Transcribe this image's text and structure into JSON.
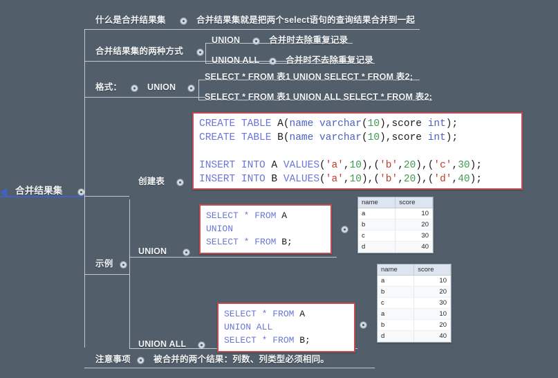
{
  "root": {
    "label": "合并结果集"
  },
  "branches": [
    {
      "key": "what",
      "label": "什么是合并结果集",
      "child": "合并结果集就是把两个select语句的查询结果合并到一起"
    },
    {
      "key": "ways",
      "label": "合并结果集的两种方式",
      "children": [
        {
          "label": "UNION",
          "desc": "合并时去除重复记录"
        },
        {
          "label": "UNION ALL",
          "desc": "合并时不去除重复记录"
        }
      ]
    },
    {
      "key": "format",
      "label": "格式：",
      "mid": "UNION",
      "children": [
        {
          "code": "SELECT * FROM 表1 UNION SELECT * FROM 表2;"
        },
        {
          "code": "SELECT * FROM 表1 UNION ALL SELECT * FROM 表2;"
        }
      ]
    },
    {
      "key": "create",
      "label": "创建表"
    },
    {
      "key": "example",
      "label": "示例",
      "children": [
        {
          "label": "UNION"
        },
        {
          "label": "UNION ALL"
        }
      ]
    },
    {
      "key": "note",
      "label": "注意事项",
      "child": "被合并的两个结果：列数、列类型必须相同。"
    }
  ],
  "code": {
    "create_tables": [
      {
        "tokens": [
          {
            "t": "CREATE TABLE ",
            "c": "kw"
          },
          {
            "t": "A(",
            "c": "pln"
          },
          {
            "t": "name varchar",
            "c": "typ"
          },
          {
            "t": "(",
            "c": "pln"
          },
          {
            "t": "10",
            "c": "num"
          },
          {
            "t": "),score ",
            "c": "pln"
          },
          {
            "t": "int",
            "c": "typ"
          },
          {
            "t": ");",
            "c": "pln"
          }
        ]
      },
      {
        "tokens": [
          {
            "t": "CREATE TABLE ",
            "c": "kw"
          },
          {
            "t": "B(",
            "c": "pln"
          },
          {
            "t": "name varchar",
            "c": "typ"
          },
          {
            "t": "(",
            "c": "pln"
          },
          {
            "t": "10",
            "c": "num"
          },
          {
            "t": "),score ",
            "c": "pln"
          },
          {
            "t": "int",
            "c": "typ"
          },
          {
            "t": ");",
            "c": "pln"
          }
        ]
      },
      {
        "tokens": []
      },
      {
        "tokens": [
          {
            "t": "INSERT INTO ",
            "c": "kw"
          },
          {
            "t": "A ",
            "c": "pln"
          },
          {
            "t": "VALUES",
            "c": "kw"
          },
          {
            "t": "(",
            "c": "pln"
          },
          {
            "t": "'a'",
            "c": "str"
          },
          {
            "t": ",",
            "c": "pln"
          },
          {
            "t": "10",
            "c": "num"
          },
          {
            "t": "),(",
            "c": "pln"
          },
          {
            "t": "'b'",
            "c": "str"
          },
          {
            "t": ",",
            "c": "pln"
          },
          {
            "t": "20",
            "c": "num"
          },
          {
            "t": "),(",
            "c": "pln"
          },
          {
            "t": "'c'",
            "c": "str"
          },
          {
            "t": ",",
            "c": "pln"
          },
          {
            "t": "30",
            "c": "num"
          },
          {
            "t": ");",
            "c": "pln"
          }
        ]
      },
      {
        "tokens": [
          {
            "t": "INSERT INTO ",
            "c": "kw"
          },
          {
            "t": "B ",
            "c": "pln"
          },
          {
            "t": "VALUES",
            "c": "kw"
          },
          {
            "t": "(",
            "c": "pln"
          },
          {
            "t": "'a'",
            "c": "str"
          },
          {
            "t": ",",
            "c": "pln"
          },
          {
            "t": "10",
            "c": "num"
          },
          {
            "t": "),(",
            "c": "pln"
          },
          {
            "t": "'b'",
            "c": "str"
          },
          {
            "t": ",",
            "c": "pln"
          },
          {
            "t": "20",
            "c": "num"
          },
          {
            "t": "),(",
            "c": "pln"
          },
          {
            "t": "'d'",
            "c": "str"
          },
          {
            "t": ",",
            "c": "pln"
          },
          {
            "t": "40",
            "c": "num"
          },
          {
            "t": ");",
            "c": "pln"
          }
        ]
      }
    ],
    "union_query": [
      {
        "tokens": [
          {
            "t": "SELECT * FROM ",
            "c": "kw"
          },
          {
            "t": "A",
            "c": "pln"
          }
        ]
      },
      {
        "tokens": [
          {
            "t": "UNION",
            "c": "kw"
          }
        ]
      },
      {
        "tokens": [
          {
            "t": "SELECT * FROM ",
            "c": "kw"
          },
          {
            "t": "B;",
            "c": "pln"
          }
        ]
      }
    ],
    "union_all_query": [
      {
        "tokens": [
          {
            "t": "SELECT * FROM ",
            "c": "kw"
          },
          {
            "t": "A",
            "c": "pln"
          }
        ]
      },
      {
        "tokens": [
          {
            "t": "UNION ALL",
            "c": "kw"
          }
        ]
      },
      {
        "tokens": [
          {
            "t": "SELECT * FROM ",
            "c": "kw"
          },
          {
            "t": "B;",
            "c": "pln"
          }
        ]
      }
    ]
  },
  "tables": {
    "union_result": {
      "columns": [
        "name",
        "score"
      ],
      "rows": [
        [
          "a",
          "10"
        ],
        [
          "b",
          "20"
        ],
        [
          "c",
          "30"
        ],
        [
          "d",
          "40"
        ]
      ]
    },
    "union_all_result": {
      "columns": [
        "name",
        "score"
      ],
      "rows": [
        [
          "a",
          "10"
        ],
        [
          "b",
          "20"
        ],
        [
          "c",
          "30"
        ],
        [
          "a",
          "10"
        ],
        [
          "b",
          "20"
        ],
        [
          "d",
          "40"
        ]
      ]
    }
  },
  "colors": {
    "background": "#525f6b",
    "line": "#d7dde1",
    "code_border": "#c34b52",
    "root_arrow": "#3f62c8"
  }
}
